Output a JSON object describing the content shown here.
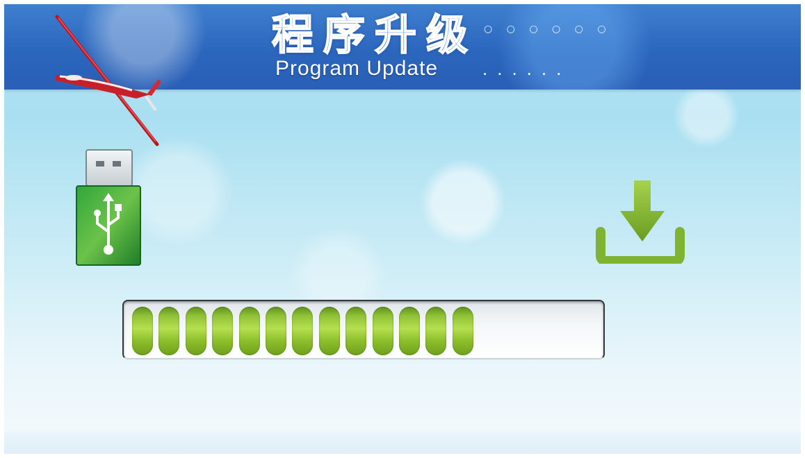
{
  "header": {
    "title_zh": "程序升级",
    "title_zh_trailing": "○ ○ ○ ○ ○ ○",
    "title_en": "Program Update",
    "title_en_trailing": "......"
  },
  "icons": {
    "logo": "glider-icon",
    "source": "usb-drive-icon",
    "action": "download-icon"
  },
  "progress": {
    "filled_segments": 13,
    "fraction": 0.7
  },
  "colors": {
    "header": "#2b66bd",
    "progress_green": "#8dbf2c",
    "usb_green": "#2c9a33",
    "download_green": "#7fb432",
    "glider_red": "#c8202a"
  }
}
